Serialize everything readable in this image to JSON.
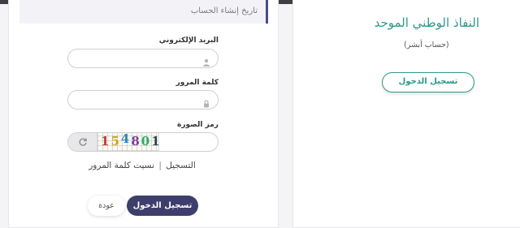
{
  "login": {
    "info_strip_text": "تاريخ إنشاء الحساب",
    "email_label": "البريد الإلكتروني",
    "email_value": "",
    "password_label": "كلمة المرور",
    "password_value": "",
    "captcha_label": "رمز الصورة",
    "captcha_text": [
      "1",
      "5",
      "4",
      "8",
      "0",
      "1"
    ],
    "captcha_value": "",
    "register_link": "التسجيل",
    "separator": "|",
    "forgot_link": "نسيت كلمة المرور",
    "login_button": "تسجيل الدخول",
    "back_button": "عودة"
  },
  "nafath": {
    "title": "النفاذ الوطني الموحد",
    "subtitle": "(حساب أبشر)",
    "login_button": "تسجيل الدخول"
  },
  "colors": {
    "primary": "#3e3e6c",
    "accent": "#2a9a8a",
    "strip_border": "#4a4a8c"
  },
  "icons": {
    "email": "user-icon",
    "password": "lock-icon",
    "refresh": "refresh-icon"
  }
}
